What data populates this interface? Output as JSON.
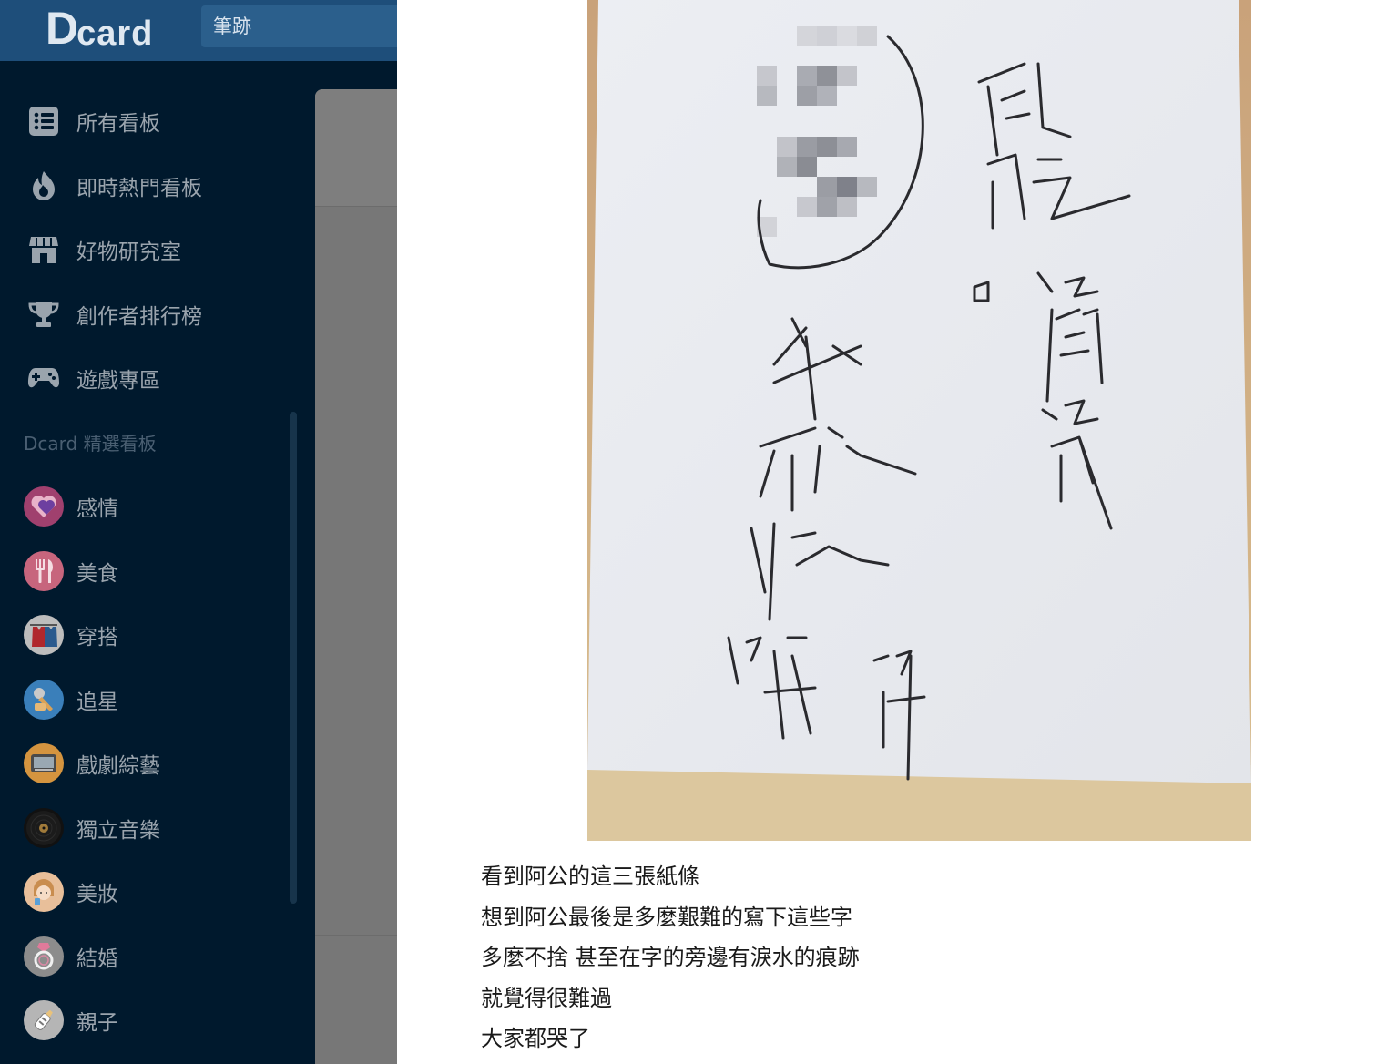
{
  "header": {
    "logo_text": "Dcard",
    "search_value": "筆跡"
  },
  "sidebar": {
    "main_items": [
      {
        "label": "所有看板",
        "icon": "list-icon"
      },
      {
        "label": "即時熱門看板",
        "icon": "flame-icon"
      },
      {
        "label": "好物研究室",
        "icon": "store-icon"
      },
      {
        "label": "創作者排行榜",
        "icon": "trophy-icon"
      },
      {
        "label": "遊戲專區",
        "icon": "gamepad-icon"
      }
    ],
    "section_title": "Dcard 精選看板",
    "boards": [
      {
        "label": "感情",
        "icon": "heart-board-icon",
        "color": "#c04f86"
      },
      {
        "label": "美食",
        "icon": "utensils-board-icon",
        "color": "#e1738f"
      },
      {
        "label": "穿搭",
        "icon": "clothes-board-icon",
        "color": "#d9d9d9"
      },
      {
        "label": "追星",
        "icon": "microphone-board-icon",
        "color": "#3f8fd0"
      },
      {
        "label": "戲劇綜藝",
        "icon": "tv-board-icon",
        "color": "#e9a64a"
      },
      {
        "label": "獨立音樂",
        "icon": "vinyl-board-icon",
        "color": "#1e1e1e"
      },
      {
        "label": "美妝",
        "icon": "makeup-board-icon",
        "color": "#f3c9a6"
      },
      {
        "label": "結婚",
        "icon": "ring-board-icon",
        "color": "#9a9a9a"
      },
      {
        "label": "親子",
        "icon": "bottle-board-icon",
        "color": "#c9c9c9"
      }
    ]
  },
  "post": {
    "image_description_icon": "handwritten-note-photo",
    "lines": [
      "看到阿公的這三張紙條",
      "想到阿公最後是多麼艱難的寫下這些字",
      "多麼不捨 甚至在字的旁邊有淚水的痕跡",
      "就覺得很難過",
      "大家都哭了"
    ]
  },
  "colors": {
    "sidebar_bg": "#00192d",
    "topbar_bg": "#1e4e7a",
    "nav_text": "#9aa4ad",
    "overlay_gray": "#777777"
  }
}
